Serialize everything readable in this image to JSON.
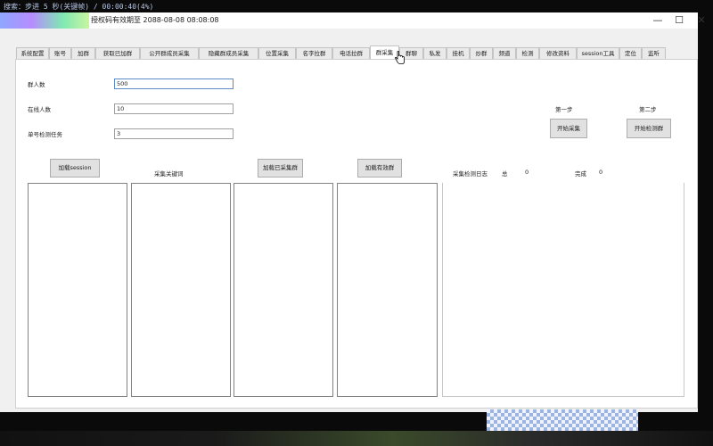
{
  "overlay": {
    "text": "搜索：步进 5 秒(关键帧) / 00:00:40(4%)"
  },
  "window": {
    "title": "授权码有效期至 2088-08-08 08:08:08",
    "controls": {
      "minimize": "—",
      "maximize": "☐",
      "close": "✕"
    }
  },
  "tabs": [
    {
      "label": "系统配置"
    },
    {
      "label": "账号"
    },
    {
      "label": "加群"
    },
    {
      "label": "获取已加群"
    },
    {
      "label": "公开群成员采集"
    },
    {
      "label": "隐藏群成员采集"
    },
    {
      "label": "位置采集"
    },
    {
      "label": "名字拉群"
    },
    {
      "label": "电话拉群"
    },
    {
      "label": "群采集"
    },
    {
      "label": "群聊"
    },
    {
      "label": "私发"
    },
    {
      "label": "挂机"
    },
    {
      "label": "炒群"
    },
    {
      "label": "频道"
    },
    {
      "label": "检测"
    },
    {
      "label": "修改资料"
    },
    {
      "label": "session工具"
    },
    {
      "label": "定位"
    },
    {
      "label": "监听"
    }
  ],
  "active_tab_index": 9,
  "form": {
    "group_size": {
      "label": "群人数",
      "value": "500"
    },
    "online_count": {
      "label": "在线人数",
      "value": "10"
    },
    "single_check_tasks": {
      "label": "单号检测任务",
      "value": "3"
    }
  },
  "steps": {
    "step1": {
      "label": "第一步",
      "button": "开始采集"
    },
    "step2": {
      "label": "第二步",
      "button": "开始检测群"
    }
  },
  "buttons": {
    "load_session": "加载session",
    "load_collected_groups": "加载已采集群",
    "load_valid_groups": "加载有效群"
  },
  "labels": {
    "collect_keywords": "采集关键词",
    "collect_log": "采集检测日志",
    "total_label": "总",
    "total_value": "0",
    "done_label": "完成",
    "done_value": "0"
  },
  "colors": {
    "panel_bg": "#ffffff",
    "window_bg": "#f0f0f0",
    "focus_border": "#5d8bc7"
  },
  "icons": {
    "cursor": "hand-pointer-icon"
  }
}
